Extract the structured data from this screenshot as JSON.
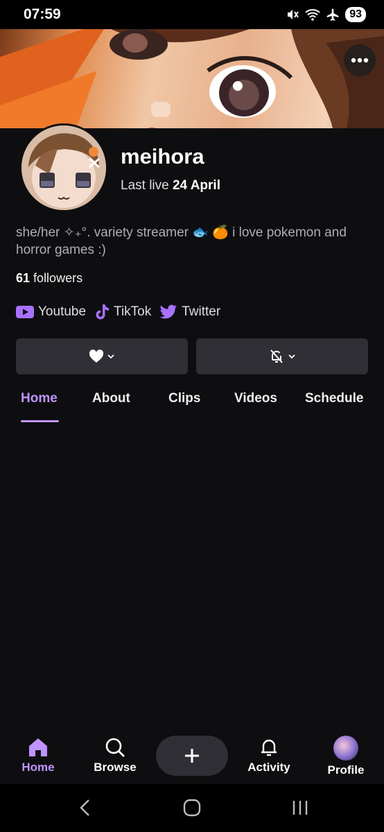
{
  "status_bar": {
    "time": "07:59",
    "battery": "93",
    "icons": [
      "mute-icon",
      "wifi-icon",
      "airplane-icon"
    ]
  },
  "channel": {
    "username": "meihora",
    "last_live_label": "Last live",
    "last_live_date": "24 April",
    "bio": "she/her ✧₊°. variety streamer 🐟 🍊 i love pokemon and horror games :)",
    "followers_count": "61",
    "followers_label": "followers"
  },
  "socials": [
    {
      "label": "Youtube",
      "icon": "youtube-icon"
    },
    {
      "label": "TikTok",
      "icon": "tiktok-icon"
    },
    {
      "label": "Twitter",
      "icon": "twitter-icon"
    }
  ],
  "actions": {
    "follow": {
      "icon": "heart-icon"
    },
    "notifications": {
      "icon": "bell-off-icon"
    }
  },
  "tabs": [
    {
      "label": "Home",
      "active": true
    },
    {
      "label": "About",
      "active": false
    },
    {
      "label": "Clips",
      "active": false
    },
    {
      "label": "Videos",
      "active": false
    },
    {
      "label": "Schedule",
      "active": false
    }
  ],
  "bottom_nav": {
    "home": "Home",
    "browse": "Browse",
    "create_icon": "plus-icon",
    "activity": "Activity",
    "profile": "Profile"
  },
  "colors": {
    "accent": "#bf94ff",
    "background": "#0e0e10",
    "button": "#2f2f35"
  }
}
